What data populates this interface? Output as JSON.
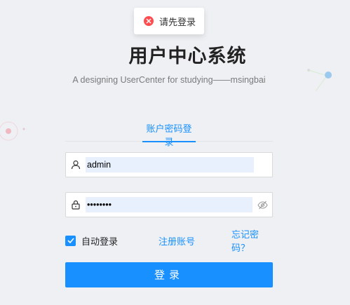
{
  "toast": {
    "message": "请先登录",
    "icon": "error-circle-icon"
  },
  "header": {
    "title": "用户中心系统",
    "subtitle": "A designing UserCenter for studying——msingbai"
  },
  "tabs": [
    {
      "label": "账户密码登录",
      "active": true
    }
  ],
  "form": {
    "username": {
      "value": "admin",
      "icon": "user-icon"
    },
    "password": {
      "value": "••••••••",
      "icon": "lock-icon",
      "toggle_icon": "eye-invisible-icon"
    },
    "auto_login": {
      "label": "自动登录",
      "checked": true
    },
    "register_link": "注册账号",
    "forgot_link": "忘记密码？",
    "submit_label": "登录"
  },
  "colors": {
    "primary": "#1890ff",
    "error": "#ff4d4f",
    "background": "#eef0f4"
  }
}
